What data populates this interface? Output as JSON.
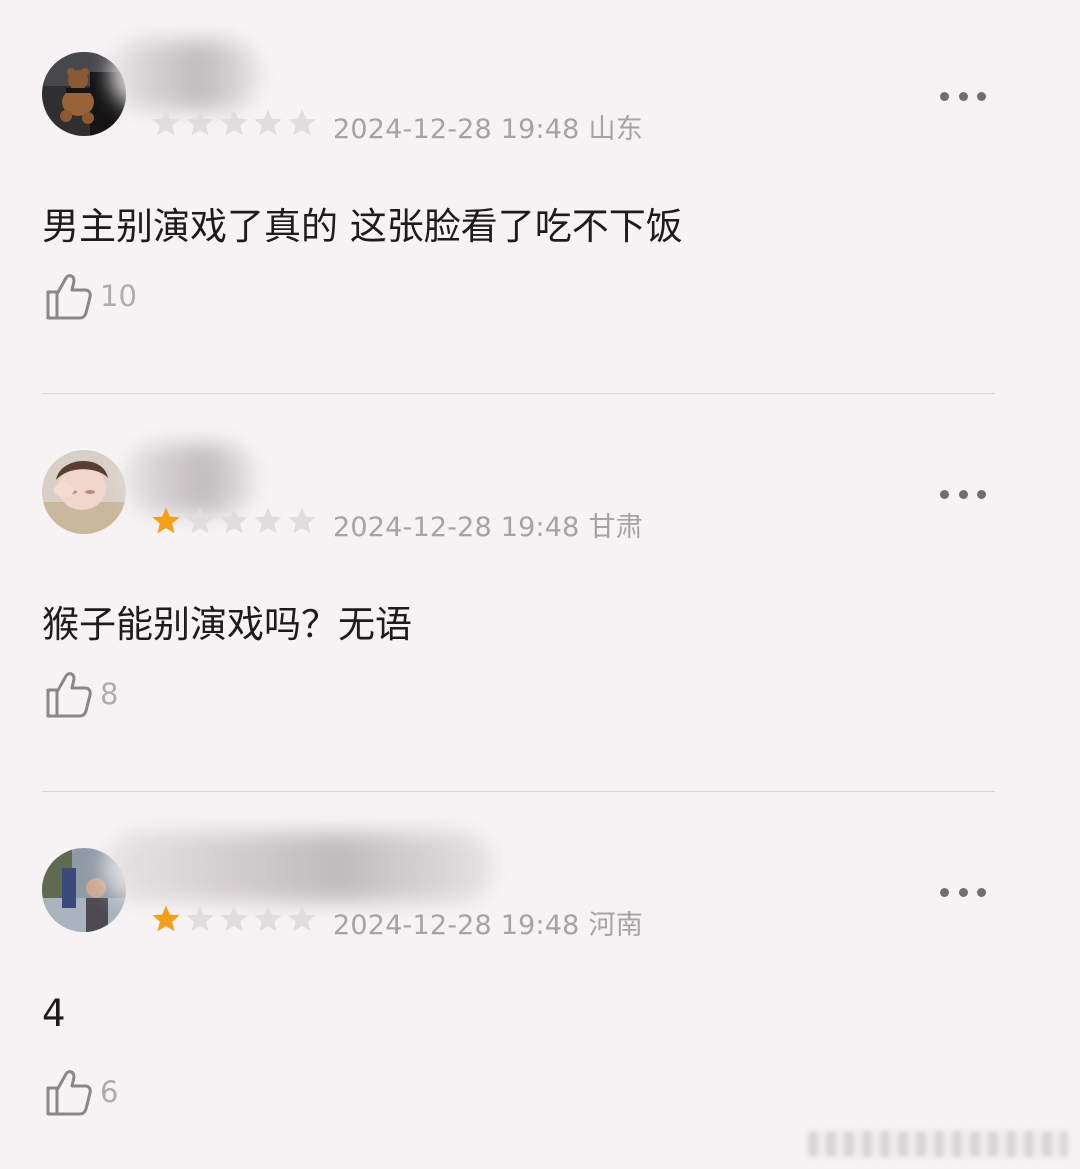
{
  "comments": [
    {
      "rating": 0,
      "time": "2024-12-28 19:48",
      "location": "山东",
      "text": "男主别演戏了真的 这张脸看了吃不下饭",
      "likes": "10"
    },
    {
      "rating": 1,
      "time": "2024-12-28 19:48",
      "location": "甘肃",
      "text": "猴子能别演戏吗？无语",
      "likes": "8"
    },
    {
      "rating": 1,
      "time": "2024-12-28 19:48",
      "location": "河南",
      "text": "4",
      "likes": "6"
    }
  ],
  "colors": {
    "star_active": "#f5a01a",
    "star_inactive": "#e1dcde",
    "background": "#f7f3f4",
    "text": "#1d1b1c",
    "meta": "#a7a3a5"
  },
  "icons": {
    "like": "thumbs-up-icon",
    "more": "more-dots-icon"
  }
}
